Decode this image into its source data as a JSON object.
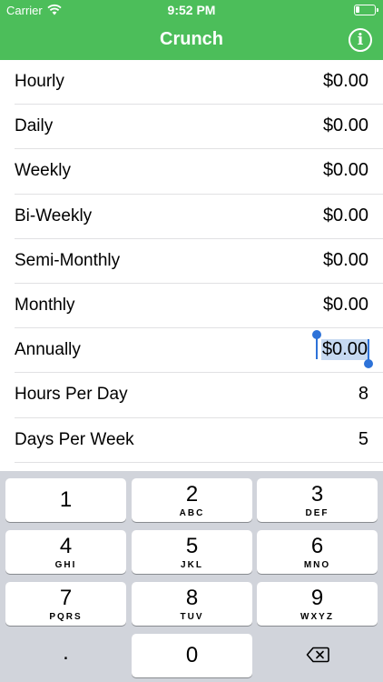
{
  "status_bar": {
    "carrier": "Carrier",
    "time": "9:52 PM",
    "wifi_icon": "wifi-icon",
    "battery_icon": "battery-low-icon"
  },
  "nav": {
    "title": "Crunch",
    "info_icon": "info-icon",
    "info_glyph": "i"
  },
  "colors": {
    "accent": "#4cbe5a",
    "selection": "#c6d9f1",
    "caret": "#2d72d8",
    "keyboard_bg": "#d1d4db"
  },
  "rows": [
    {
      "label": "Hourly",
      "value": "$0.00"
    },
    {
      "label": "Daily",
      "value": "$0.00"
    },
    {
      "label": "Weekly",
      "value": "$0.00"
    },
    {
      "label": "Bi-Weekly",
      "value": "$0.00"
    },
    {
      "label": "Semi-Monthly",
      "value": "$0.00"
    },
    {
      "label": "Monthly",
      "value": "$0.00"
    },
    {
      "label": "Annually",
      "value": "$0.00",
      "selected": true
    },
    {
      "label": "Hours Per Day",
      "value": "8"
    },
    {
      "label": "Days Per Week",
      "value": "5"
    }
  ],
  "keyboard": {
    "keys": [
      {
        "digit": "1",
        "letters": ""
      },
      {
        "digit": "2",
        "letters": "ABC"
      },
      {
        "digit": "3",
        "letters": "DEF"
      },
      {
        "digit": "4",
        "letters": "GHI"
      },
      {
        "digit": "5",
        "letters": "JKL"
      },
      {
        "digit": "6",
        "letters": "MNO"
      },
      {
        "digit": "7",
        "letters": "PQRS"
      },
      {
        "digit": "8",
        "letters": "TUV"
      },
      {
        "digit": "9",
        "letters": "WXYZ"
      }
    ],
    "dot": ".",
    "zero": "0",
    "delete_icon": "backspace-icon"
  }
}
